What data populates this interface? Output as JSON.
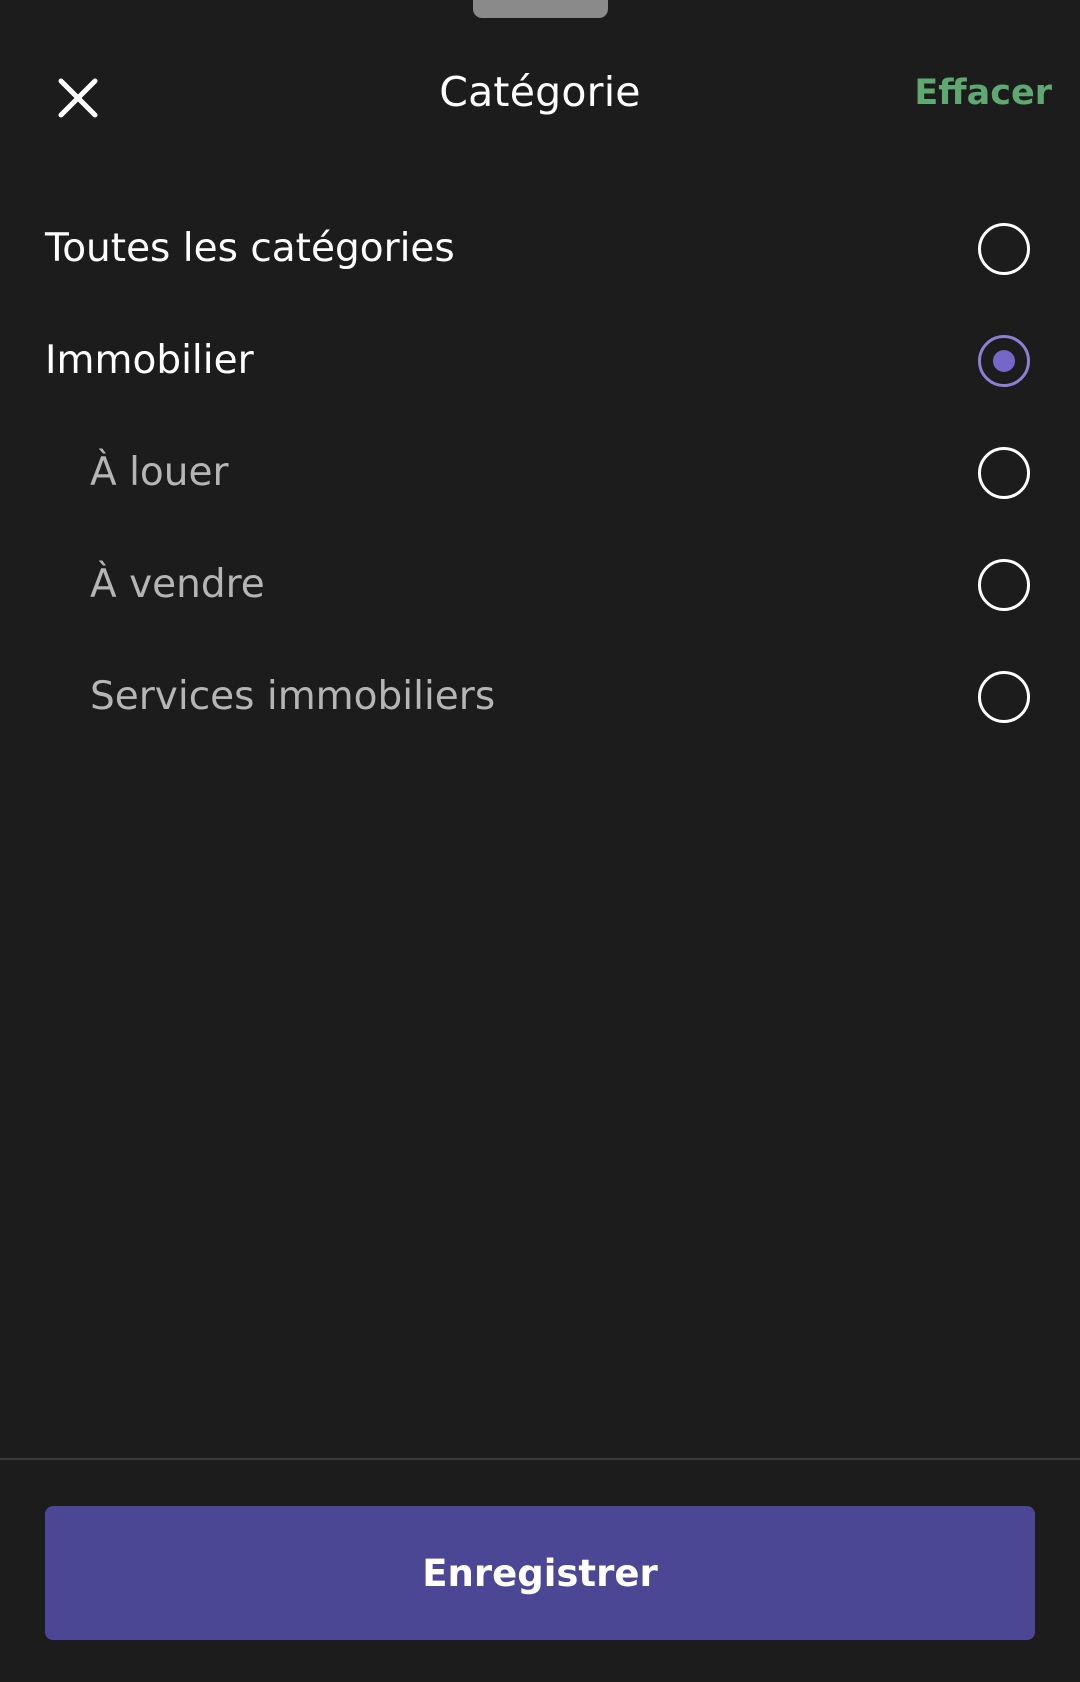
{
  "header": {
    "title": "Catégorie",
    "close_icon": "close-icon",
    "clear_label": "Effacer",
    "clear_color": "#5fa872"
  },
  "options": [
    {
      "label": "Toutes les catégories",
      "selected": false,
      "level": 0
    },
    {
      "label": "Immobilier",
      "selected": true,
      "level": 0
    },
    {
      "label": "À louer",
      "selected": false,
      "level": 1
    },
    {
      "label": "À vendre",
      "selected": false,
      "level": 1
    },
    {
      "label": "Services immobiliers",
      "selected": false,
      "level": 1
    }
  ],
  "footer": {
    "save_label": "Enregistrer",
    "save_color": "#4b4795"
  },
  "colors": {
    "background": "#1c1c1c",
    "accent": "#7467c9"
  }
}
